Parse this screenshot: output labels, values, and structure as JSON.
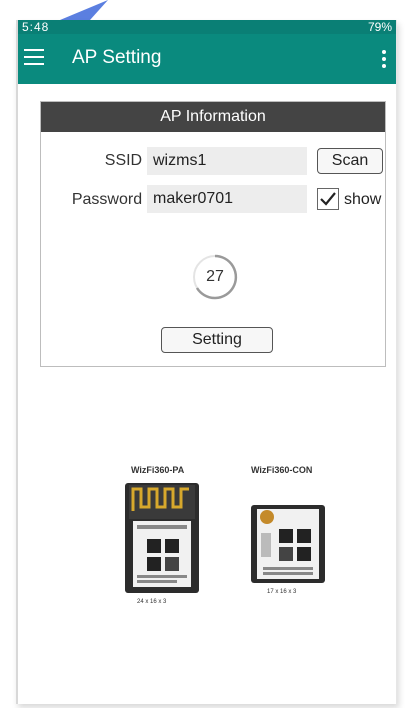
{
  "status_bar": {
    "time": "5:48",
    "battery": "79%"
  },
  "app_bar": {
    "title": "AP Setting"
  },
  "card": {
    "header": "AP Information",
    "ssid_label": "SSID :",
    "ssid_value": "wizms1",
    "scan_button": "Scan",
    "password_label": "Password :",
    "password_value": "maker0701",
    "show_label": "show",
    "show_checked": true,
    "progress_count": "27",
    "setting_button": "Setting"
  },
  "modules": {
    "left": {
      "name": "WizFi360-PA",
      "dimensions": "24 x 16 x 3"
    },
    "right": {
      "name": "WizFi360-CON",
      "dimensions": "17 x 16 x 3"
    }
  },
  "colors": {
    "accent": "#0a8a7e",
    "header_dark": "#444444"
  },
  "icons": [
    "menu-icon",
    "overflow-menu-icon",
    "checkbox-check-icon",
    "progress-spinner-icon"
  ]
}
